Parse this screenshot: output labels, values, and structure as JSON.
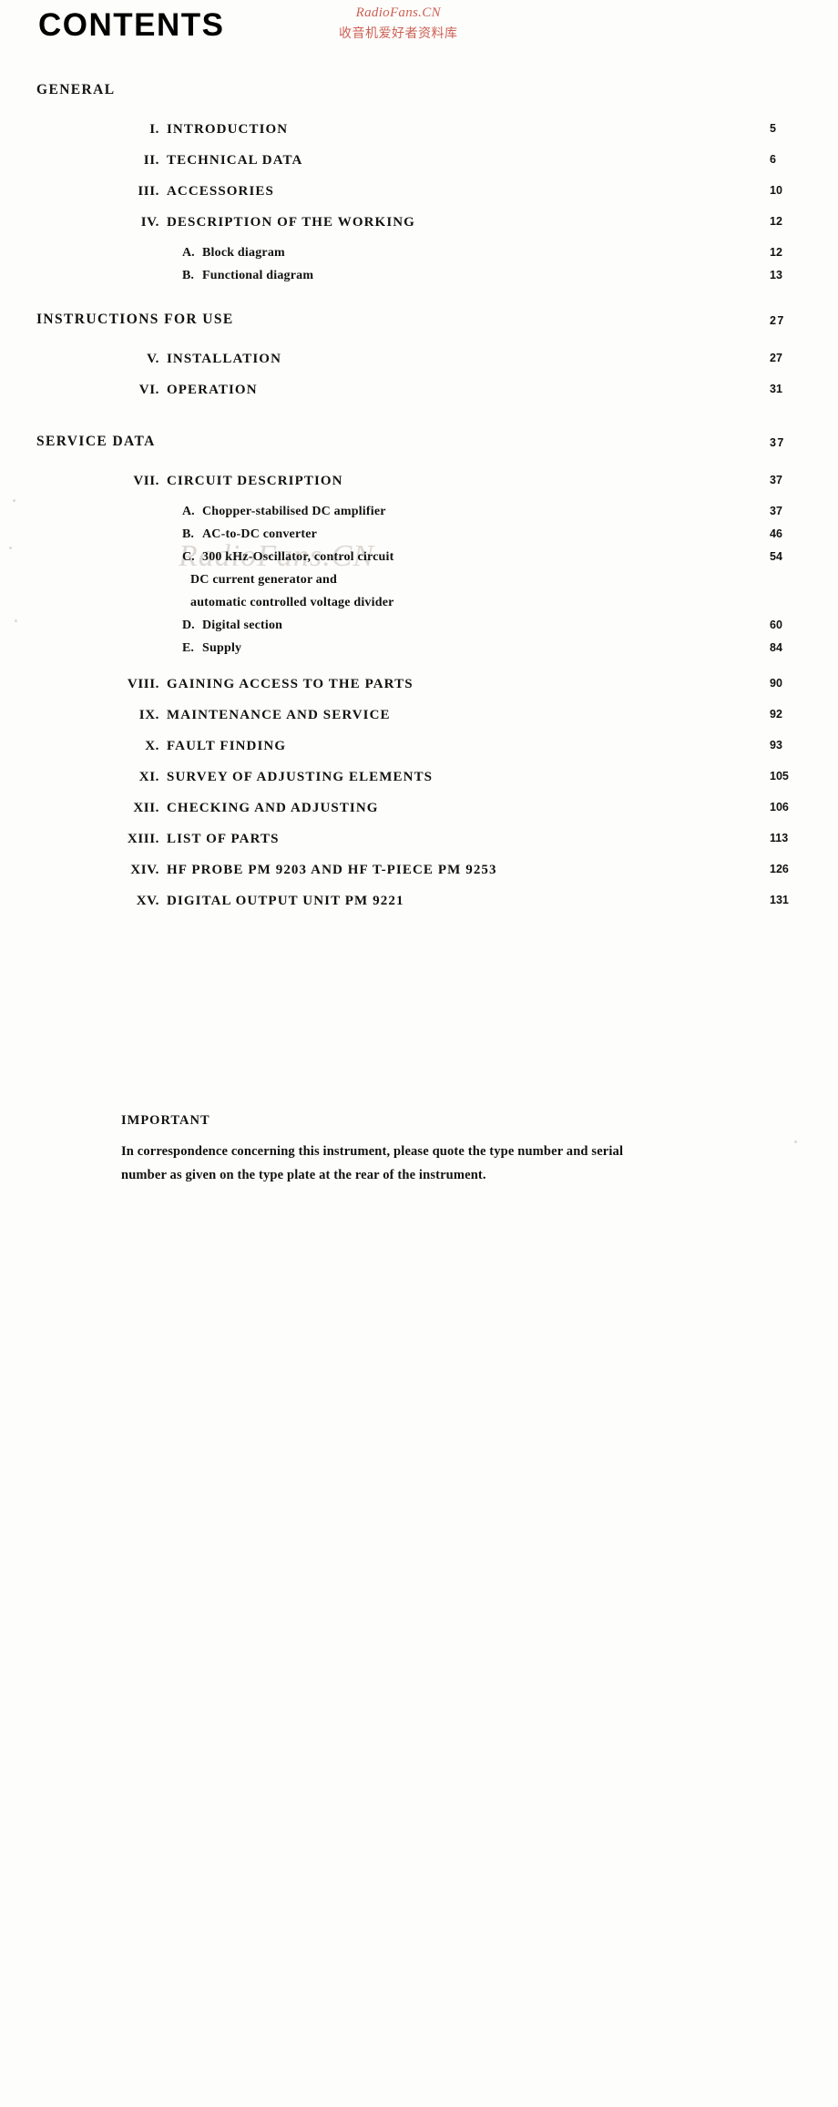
{
  "header": {
    "title": "CONTENTS",
    "watermark_line1": "RadioFans.CN",
    "watermark_line2": "收音机爱好者资料库",
    "watermark_center": "RadioFans.CN",
    "watermark_color": "#c0392b"
  },
  "toc": {
    "sections": [
      {
        "title": "GENERAL",
        "page": "",
        "entries": [
          {
            "num": "I.",
            "label": "INTRODUCTION",
            "page": "5",
            "subs": []
          },
          {
            "num": "II.",
            "label": "TECHNICAL DATA",
            "page": "6",
            "subs": []
          },
          {
            "num": "III.",
            "label": "ACCESSORIES",
            "page": "10",
            "subs": []
          },
          {
            "num": "IV.",
            "label": "DESCRIPTION OF THE WORKING",
            "page": "12",
            "subs": [
              {
                "letter": "A.",
                "text": "Block diagram",
                "page": "12"
              },
              {
                "letter": "B.",
                "text": "Functional diagram",
                "page": "13"
              }
            ]
          }
        ]
      },
      {
        "title": "INSTRUCTIONS FOR USE",
        "page": "27",
        "entries": [
          {
            "num": "V.",
            "label": "INSTALLATION",
            "page": "27",
            "subs": []
          },
          {
            "num": "VI.",
            "label": "OPERATION",
            "page": "31",
            "subs": []
          }
        ]
      },
      {
        "title": "SERVICE DATA",
        "page": "37",
        "entries": [
          {
            "num": "VII.",
            "label": "CIRCUIT DESCRIPTION",
            "page": "37",
            "subs": [
              {
                "letter": "A.",
                "text": "Chopper-stabilised DC amplifier",
                "page": "37"
              },
              {
                "letter": "B.",
                "text": "AC-to-DC converter",
                "page": "46"
              },
              {
                "letter": "C.",
                "text": "300 kHz-Oscillator, control circuit",
                "page": "54"
              },
              {
                "letter": "",
                "text": "DC current generator and",
                "page": "",
                "continuation": true
              },
              {
                "letter": "",
                "text": "automatic controlled voltage divider",
                "page": "",
                "continuation": true
              },
              {
                "letter": "D.",
                "text": "Digital section",
                "page": "60"
              },
              {
                "letter": "E.",
                "text": "Supply",
                "page": "84"
              }
            ]
          },
          {
            "num": "VIII.",
            "label": "GAINING ACCESS TO THE PARTS",
            "page": "90",
            "subs": []
          },
          {
            "num": "IX.",
            "label": "MAINTENANCE AND SERVICE",
            "page": "92",
            "subs": []
          },
          {
            "num": "X.",
            "label": "FAULT FINDING",
            "page": "93",
            "subs": []
          },
          {
            "num": "XI.",
            "label": "SURVEY OF ADJUSTING ELEMENTS",
            "page": "105",
            "subs": []
          },
          {
            "num": "XII.",
            "label": "CHECKING AND ADJUSTING",
            "page": "106",
            "subs": []
          },
          {
            "num": "XIII.",
            "label": "LIST OF PARTS",
            "page": "113",
            "subs": []
          },
          {
            "num": "XIV.",
            "label": "HF PROBE PM 9203 AND HF T-PIECE PM 9253",
            "page": "126",
            "subs": []
          },
          {
            "num": "XV.",
            "label": "DIGITAL OUTPUT UNIT PM 9221",
            "page": "131",
            "subs": []
          }
        ]
      }
    ]
  },
  "important": {
    "title": "IMPORTANT",
    "line1": "In correspondence concerning this instrument, please quote the type number and serial",
    "line2": "number as given on the type plate at the rear of the instrument."
  }
}
